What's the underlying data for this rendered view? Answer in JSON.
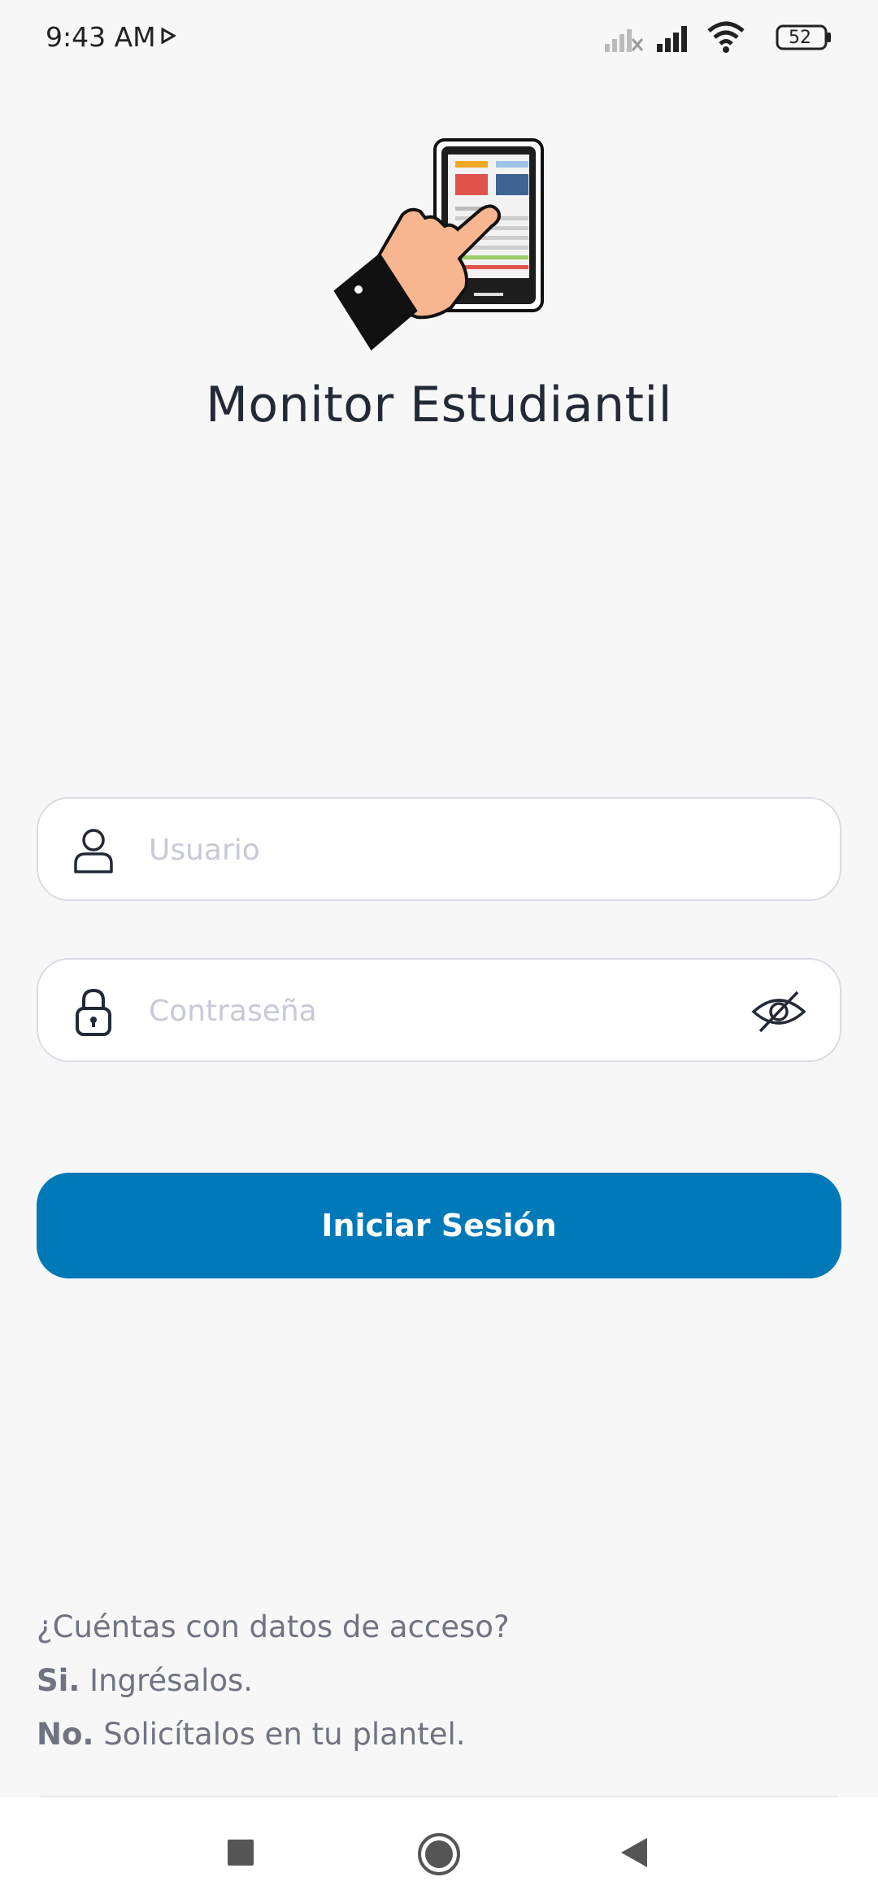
{
  "status_bar": {
    "time": "9:43 AM",
    "battery": "52",
    "icons": [
      "play-icon",
      "signal-off-icon",
      "signal-icon",
      "wifi-icon",
      "battery-icon"
    ]
  },
  "app": {
    "title": "Monitor Estudiantil"
  },
  "form": {
    "username_placeholder": "Usuario",
    "username_value": "",
    "password_placeholder": "Contraseña",
    "password_value": "",
    "login_label": "Iniciar Sesión"
  },
  "help": {
    "question": "¿Cuéntas con datos de acceso?",
    "yes_bold": "Si.",
    "yes_text": " Ingrésalos.",
    "no_bold": "No.",
    "no_text": " Solicítalos en tu plantel."
  },
  "colors": {
    "accent": "#0079b8",
    "background": "#f7f7f8",
    "title": "#232a36"
  }
}
